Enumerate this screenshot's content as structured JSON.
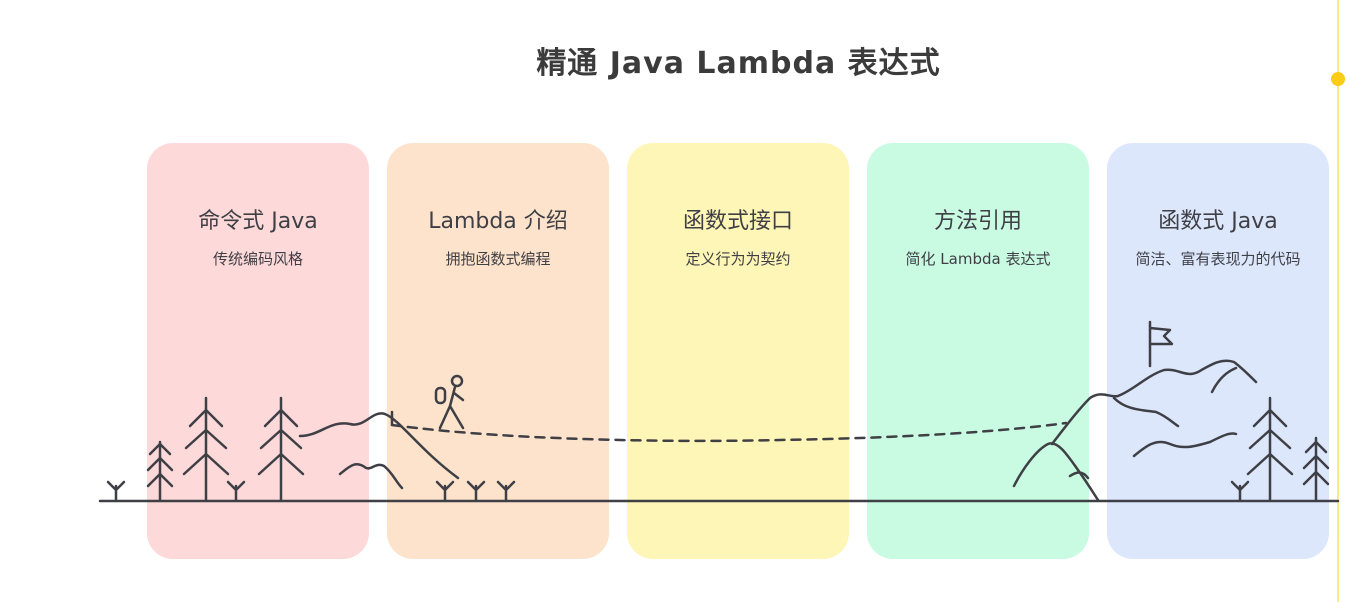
{
  "title": "精通 Java Lambda 表达式",
  "stages": [
    {
      "title": "命令式 Java",
      "subtitle": "传统编码风格",
      "color": "#fdd9d9"
    },
    {
      "title": "Lambda 介绍",
      "subtitle": "拥抱函数式编程",
      "color": "#fde3cb"
    },
    {
      "title": "函数式接口",
      "subtitle": "定义行为为契约",
      "color": "#fef6b6"
    },
    {
      "title": "方法引用",
      "subtitle": "简化 Lambda 表达式",
      "color": "#c9fbe3"
    },
    {
      "title": "函数式 Java",
      "subtitle": "简洁、富有表现力的代码",
      "color": "#dce7fc"
    }
  ],
  "colors": {
    "stroke": "#3f3f46",
    "accent_line": "#fde68a",
    "accent_dot": "#facc15"
  },
  "icons": [
    "pine-tree-icon",
    "grass-sprout-icon",
    "hiker-icon",
    "mountain-icon",
    "flag-icon"
  ]
}
